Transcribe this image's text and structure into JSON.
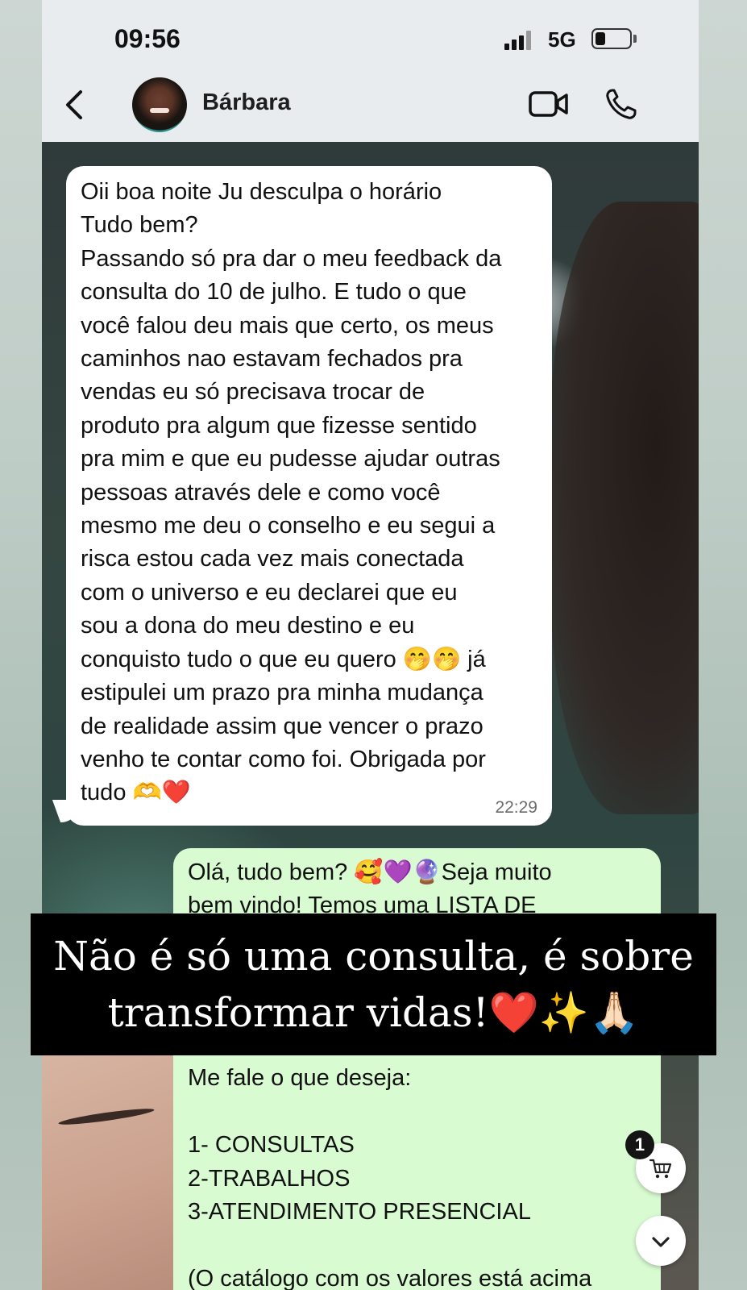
{
  "status_bar": {
    "time": "09:56",
    "network": "5G"
  },
  "header": {
    "contact_name": "Bárbara",
    "back_icon": "chevron-left-icon",
    "video_icon": "video-call-icon",
    "phone_icon": "phone-icon"
  },
  "messages": {
    "incoming": {
      "text": "Oii boa noite Ju desculpa o horário\nTudo bem?\nPassando só pra dar o meu feedback da\nconsulta do 10 de julho. E tudo o que\nvocê falou deu mais que certo, os meus\ncaminhos nao estavam fechados pra\nvendas eu só precisava trocar de\nproduto pra algum que fizesse sentido\npra mim e que eu pudesse ajudar outras\npessoas através dele e como você\nmesmo me deu o conselho e eu segui a\nrisca estou cada vez mais conectada\ncom o universo e eu declarei que eu\nsou a dona do meu destino e eu\nconquisto tudo o que eu quero 🤭🤭 já\nestipulei um prazo pra minha mudança\nde realidade assim que vencer o prazo\nvenho te contar como foi. Obrigada por\ntudo 🫶❤️",
      "time": "22:29"
    },
    "outgoing": {
      "text_top": "Olá, tudo bem? 🥰💜🔮Seja muito\nbem vindo! Temos uma LISTA DE",
      "text_bottom": "Me fale o que deseja:\n\n1- CONSULTAS\n2-TRABALHOS\n3-ATENDIMENTO PRESENCIAL\n\n(O catálogo com os valores está acima"
    }
  },
  "caption": {
    "text": "Não é só uma consulta, é sobre\ntransformar vidas!❤️✨🙏🏻"
  },
  "cart": {
    "badge_count": "1",
    "icon": "cart-icon"
  },
  "scroll_button": {
    "icon": "chevron-down-icon"
  },
  "colors": {
    "incoming_bubble": "#ffffff",
    "outgoing_bubble": "#d9fbd2",
    "header_bg": "#e9ecee",
    "caption_bg": "#000000"
  }
}
